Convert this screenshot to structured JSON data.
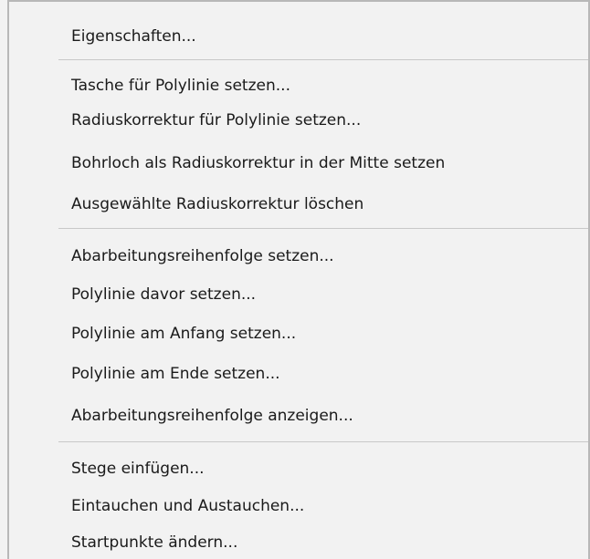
{
  "menu": {
    "items": [
      {
        "label": "Eigenschaften..."
      },
      {
        "label": "Tasche für Polylinie setzen..."
      },
      {
        "label": "Radiuskorrektur für Polylinie setzen..."
      },
      {
        "label": "Bohrloch als Radiuskorrektur in der Mitte setzen"
      },
      {
        "label": "Ausgewählte Radiuskorrektur löschen"
      },
      {
        "label": "Abarbeitungsreihenfolge setzen..."
      },
      {
        "label": "Polylinie davor setzen..."
      },
      {
        "label": "Polylinie am Anfang setzen..."
      },
      {
        "label": "Polylinie am Ende setzen..."
      },
      {
        "label": "Abarbeitungsreihenfolge anzeigen..."
      },
      {
        "label": "Stege einfügen..."
      },
      {
        "label": "Eintauchen und Austauchen..."
      },
      {
        "label": "Startpunkte ändern..."
      }
    ]
  }
}
